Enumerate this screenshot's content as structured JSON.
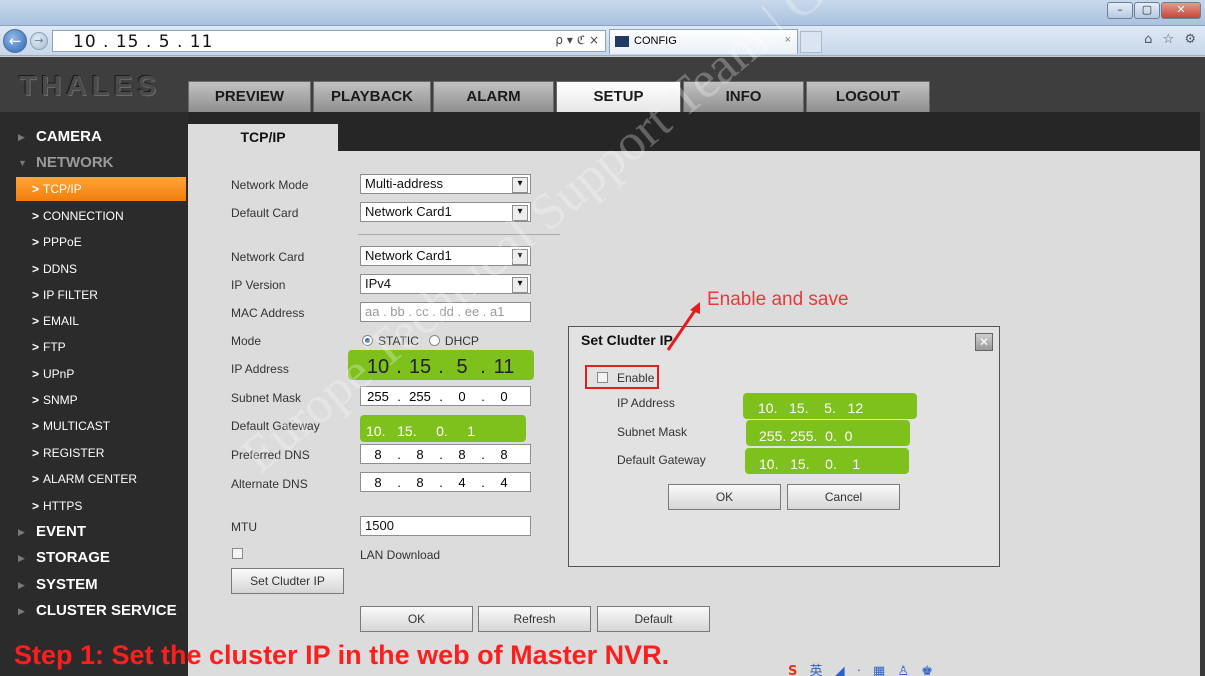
{
  "browser": {
    "address": [
      "10",
      "15",
      "5",
      "11"
    ],
    "address_icons": "ρ ▾ ℭ ×",
    "tab_title": "CONFIG",
    "tab_close": "×",
    "toolbar_icons": "⌂ ☆ ⚙",
    "window_buttons": [
      "–",
      "▢",
      "✕"
    ]
  },
  "app": {
    "logo": "THALES",
    "topnav": [
      {
        "label": "PREVIEW",
        "active": false
      },
      {
        "label": "PLAYBACK",
        "active": false
      },
      {
        "label": "ALARM",
        "active": false
      },
      {
        "label": "SETUP",
        "active": true
      },
      {
        "label": "INFO",
        "active": false
      },
      {
        "label": "LOGOUT",
        "active": false
      }
    ],
    "subtab": "TCP/IP",
    "sidebar": {
      "sections": [
        "CAMERA",
        "NETWORK",
        "EVENT",
        "STORAGE",
        "SYSTEM",
        "CLUSTER SERVICE"
      ],
      "network_items": [
        "TCP/IP",
        "CONNECTION",
        "PPPoE",
        "DDNS",
        "IP FILTER",
        "EMAIL",
        "FTP",
        "UPnP",
        "SNMP",
        "MULTICAST",
        "REGISTER",
        "ALARM CENTER",
        "HTTPS"
      ],
      "active_item": "TCP/IP"
    }
  },
  "form": {
    "network_mode": {
      "label": "Network Mode",
      "value": "Multi-address"
    },
    "default_card": {
      "label": "Default Card",
      "value": "Network Card1"
    },
    "network_card": {
      "label": "Network Card",
      "value": "Network Card1"
    },
    "ip_version": {
      "label": "IP Version",
      "value": "IPv4"
    },
    "mac_address": {
      "label": "MAC Address",
      "value": "aa . bb . cc . dd . ee . a1"
    },
    "mode": {
      "label": "Mode",
      "static": "STATIC",
      "dhcp": "DHCP"
    },
    "ip_address": {
      "label": "IP Address",
      "octets": [
        "10",
        "15",
        "5",
        "11"
      ]
    },
    "subnet_mask": {
      "label": "Subnet Mask",
      "octets": [
        "255",
        "255",
        "0",
        "0"
      ]
    },
    "default_gateway": {
      "label": "Default Gateway",
      "octets": [
        "10",
        "15",
        "0",
        "1"
      ]
    },
    "preferred_dns": {
      "label": "Preferred DNS",
      "octets": [
        "8",
        "8",
        "8",
        "8"
      ]
    },
    "alternate_dns": {
      "label": "Alternate DNS",
      "octets": [
        "8",
        "8",
        "4",
        "4"
      ]
    },
    "mtu": {
      "label": "MTU",
      "value": "1500"
    },
    "lan_download": "LAN Download",
    "set_cluster_button": "Set Cludter IP",
    "ok_button": "OK",
    "refresh_button": "Refresh",
    "default_button": "Default"
  },
  "dialog": {
    "title": "Set Cludter IP",
    "close": "✕",
    "enable_label": "Enable",
    "ip_address": {
      "label": "IP Address",
      "octets": [
        "10",
        "15",
        "5",
        "12"
      ]
    },
    "subnet_mask": {
      "label": "Subnet Mask",
      "octets": [
        "255",
        "255",
        "0",
        "0"
      ]
    },
    "default_gateway": {
      "label": "Default Gateway",
      "octets": [
        "10",
        "15",
        "0",
        "1"
      ]
    },
    "ok_button": "OK",
    "cancel_button": "Cancel"
  },
  "annotation": {
    "callout": "Enable and save",
    "step": "Step 1: Set the cluster IP in the web of Master NVR.",
    "watermark": "Europe Technical Support Team | Gavin"
  },
  "taskbar": {
    "ime_glyph": "S",
    "ime_text": "英 ◢ ⋅ ▦ ♙ ♚ ✎"
  },
  "colors": {
    "accent": "#f17e0a",
    "highlight": "#7ec11d",
    "annotation": "#e31e1e"
  }
}
